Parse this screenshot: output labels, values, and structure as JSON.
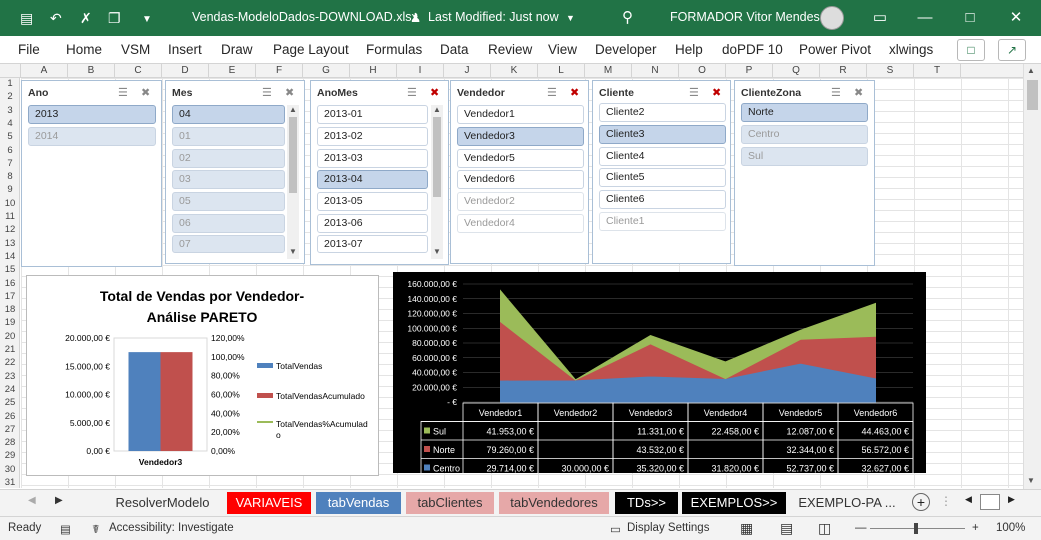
{
  "titlebar": {
    "filename": "Vendas-ModeloDados-DOWNLOAD.xlsx",
    "modified": "Last Modified: Just now",
    "user": "FORMADOR Vitor Mendes"
  },
  "menu": [
    "File",
    "Home",
    "VSM",
    "Insert",
    "Draw",
    "Page Layout",
    "Formulas",
    "Data",
    "Review",
    "View",
    "Developer",
    "Help",
    "doPDF 10",
    "Power Pivot",
    "xlwings"
  ],
  "columns": [
    "A",
    "B",
    "C",
    "D",
    "E",
    "F",
    "G",
    "H",
    "I",
    "J",
    "K",
    "L",
    "M",
    "N",
    "O",
    "P",
    "Q",
    "R",
    "S",
    "T"
  ],
  "rows": [
    "1",
    "2",
    "3",
    "4",
    "5",
    "6",
    "7",
    "8",
    "9",
    "10",
    "11",
    "12",
    "13",
    "14",
    "15",
    "16",
    "17",
    "18",
    "19",
    "20",
    "21",
    "22",
    "23",
    "24",
    "25",
    "26",
    "27",
    "28",
    "29",
    "30",
    "31"
  ],
  "slicers": {
    "ano": {
      "title": "Ano",
      "items": [
        "2013",
        "2014"
      ]
    },
    "mes": {
      "title": "Mes",
      "items": [
        "04",
        "01",
        "02",
        "03",
        "05",
        "06",
        "07"
      ]
    },
    "anomes": {
      "title": "AnoMes",
      "items": [
        "2013-01",
        "2013-02",
        "2013-03",
        "2013-04",
        "2013-05",
        "2013-06",
        "2013-07"
      ]
    },
    "vendedor": {
      "title": "Vendedor",
      "items": [
        "Vendedor1",
        "Vendedor3",
        "Vendedor5",
        "Vendedor6",
        "Vendedor2",
        "Vendedor4"
      ]
    },
    "cliente": {
      "title": "Cliente",
      "items": [
        "Cliente2",
        "Cliente3",
        "Cliente4",
        "Cliente5",
        "Cliente6",
        "Cliente1"
      ]
    },
    "clientezona": {
      "title": "ClienteZona",
      "items": [
        "Norte",
        "Centro",
        "Sul"
      ]
    }
  },
  "chart_data": [
    {
      "type": "bar",
      "title": "Total de Vendas por Vendedor- Análise PARETO",
      "categories": [
        "Vendedor3"
      ],
      "series": [
        {
          "name": "TotalVendas",
          "values": [
            17500
          ]
        },
        {
          "name": "TotalVendasAcumulado",
          "values": [
            17500
          ]
        },
        {
          "name": "TotalVendas%Acumulado",
          "values": [
            100
          ]
        }
      ],
      "ylim": [
        0,
        20000
      ],
      "y2lim": [
        0,
        120
      ],
      "yticks": [
        "0,00 €",
        "5.000,00 €",
        "10.000,00 €",
        "15.000,00 €",
        "20.000,00 €"
      ],
      "y2ticks": [
        "0,00%",
        "20,00%",
        "40,00%",
        "60,00%",
        "80,00%",
        "100,00%",
        "120,00%"
      ],
      "legend_position": "right",
      "colors": [
        "#4f81bd",
        "#c0504d",
        "#9bbb59"
      ]
    },
    {
      "type": "area",
      "categories": [
        "Vendedor1",
        "Vendedor2",
        "Vendedor3",
        "Vendedor4",
        "Vendedor5",
        "Vendedor6"
      ],
      "series": [
        {
          "name": "Sul",
          "values": [
            41953,
            0,
            11331,
            22458,
            12087,
            44463
          ],
          "labels": [
            "41.953,00 €",
            "",
            "11.331,00 €",
            "22.458,00 €",
            "12.087,00 €",
            "44.463,00 €"
          ],
          "color": "#9bbb59"
        },
        {
          "name": "Norte",
          "values": [
            79260,
            0,
            43532,
            0,
            32344,
            56572
          ],
          "labels": [
            "79.260,00 €",
            "",
            "43.532,00 €",
            "",
            "32.344,00 €",
            "56.572,00 €"
          ],
          "color": "#c0504d"
        },
        {
          "name": "Centro",
          "values": [
            29714,
            30000,
            35320,
            31820,
            52737,
            32627
          ],
          "labels": [
            "29.714,00 €",
            "30.000,00 €",
            "35.320,00 €",
            "31.820,00 €",
            "52.737,00 €",
            "32.627,00 €"
          ],
          "color": "#4f81bd"
        }
      ],
      "ylim": [
        0,
        160000
      ],
      "yticks": [
        "-   €",
        "20.000,00 €",
        "40.000,00 €",
        "60.000,00 €",
        "80.000,00 €",
        "100.000,00 €",
        "120.000,00 €",
        "140.000,00 €",
        "160.000,00 €"
      ],
      "stacked": true,
      "data_table": true
    }
  ],
  "tabs": [
    {
      "label": "ResolverModelo",
      "bg": "#f3f3f3",
      "fg": "#333"
    },
    {
      "label": "VARIAVEIS",
      "bg": "#ff0000",
      "fg": "#fff"
    },
    {
      "label": "tabVendas",
      "bg": "#4f81bd",
      "fg": "#fff"
    },
    {
      "label": "tabClientes",
      "bg": "#e6a8a8",
      "fg": "#333"
    },
    {
      "label": "tabVendedores",
      "bg": "#e6a8a8",
      "fg": "#333"
    },
    {
      "label": "TDs>>",
      "bg": "#000",
      "fg": "#fff"
    },
    {
      "label": "EXEMPLOS>>",
      "bg": "#000",
      "fg": "#fff"
    },
    {
      "label": "EXEMPLO-PA ...",
      "bg": "#f3f3f3",
      "fg": "#333"
    }
  ],
  "status": {
    "ready": "Ready",
    "accessibility": "Accessibility: Investigate",
    "display": "Display Settings",
    "zoom": "100%"
  }
}
